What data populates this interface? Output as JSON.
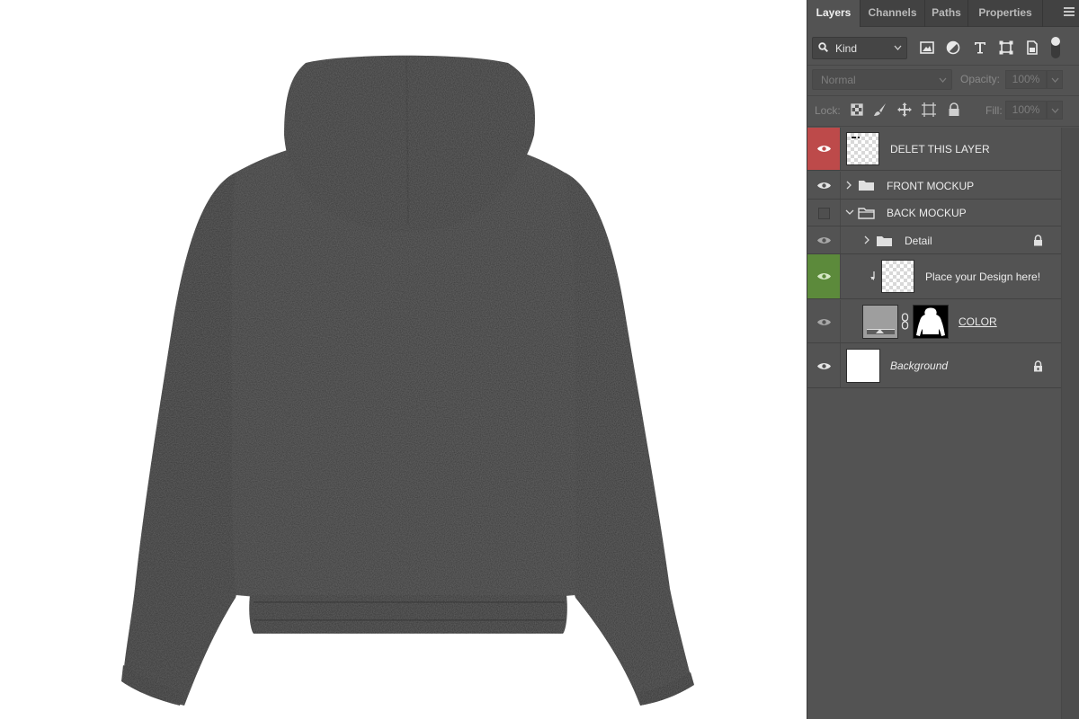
{
  "canvas": {
    "image": "hoodie-back-mockup",
    "hoodie_color": "#3a3a3a"
  },
  "panel": {
    "tabs": [
      {
        "label": "Layers",
        "active": true
      },
      {
        "label": "Channels",
        "active": false
      },
      {
        "label": "Paths",
        "active": false
      },
      {
        "label": "Properties",
        "active": false
      }
    ],
    "menu_icon": "hamburger-icon",
    "filter": {
      "kind_label": "Kind",
      "icons": [
        "image-filter-icon",
        "adjustment-filter-icon",
        "type-filter-icon",
        "shape-filter-icon",
        "smart-object-filter-icon"
      ]
    },
    "blend": {
      "mode": "Normal",
      "opacity_label": "Opacity:",
      "opacity_value": "100%"
    },
    "lock": {
      "label": "Lock:",
      "icons": [
        "lock-transparent-icon",
        "lock-paint-icon",
        "lock-position-icon",
        "lock-artboard-icon",
        "lock-all-icon"
      ],
      "fill_label": "Fill:",
      "fill_value": "100%"
    },
    "layers": [
      {
        "name": "DELET THIS LAYER",
        "type": "pixel",
        "visible": true,
        "tag_color": "#bd4a4a"
      },
      {
        "name": "FRONT MOCKUP",
        "type": "group",
        "visible": true,
        "expanded": false
      },
      {
        "name": "BACK MOCKUP",
        "type": "group",
        "visible": false,
        "expanded": true
      },
      {
        "name": "Detail",
        "type": "group",
        "visible": true,
        "expanded": false,
        "locked": true
      },
      {
        "name": "Place your Design here!",
        "type": "smart-object",
        "visible": true,
        "clipped": true,
        "tag_color": "#5c8a3b"
      },
      {
        "name": "COLOR",
        "type": "fill-with-mask",
        "visible": true
      },
      {
        "name": "Background",
        "type": "background",
        "visible": true,
        "locked": true
      }
    ]
  }
}
